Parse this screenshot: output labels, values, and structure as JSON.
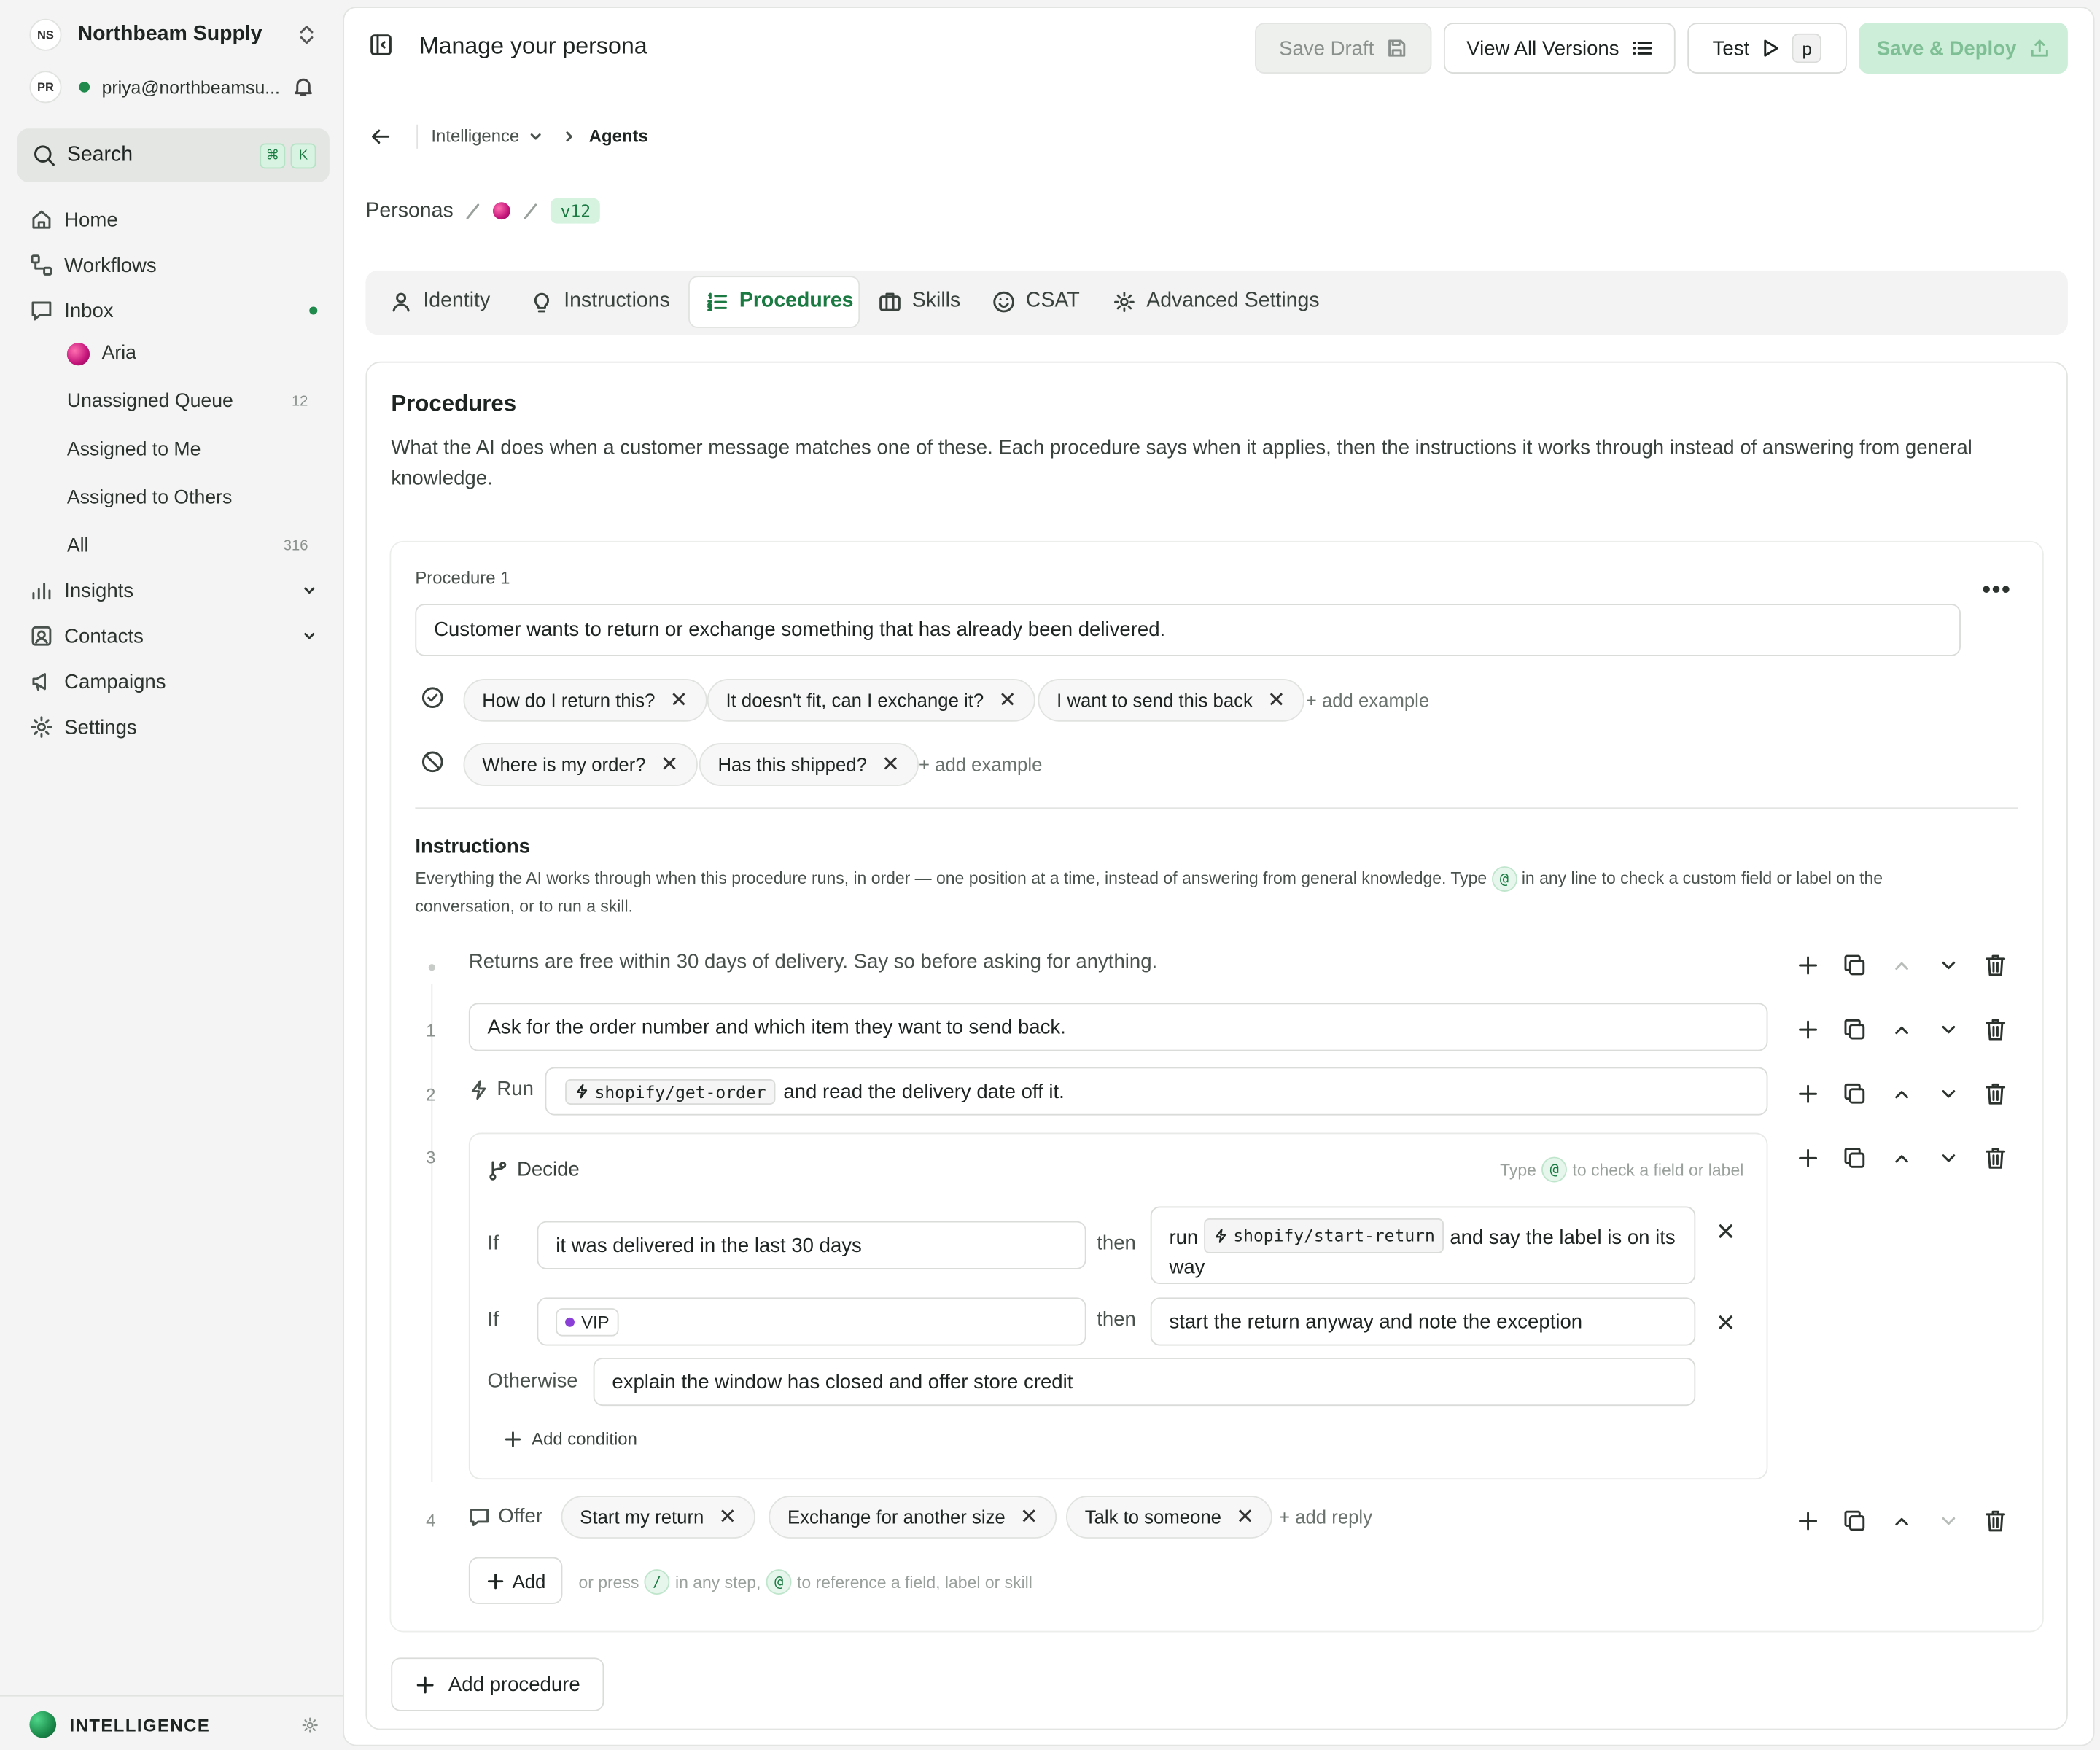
{
  "workspace": {
    "initials": "NS",
    "name": "Northbeam Supply",
    "user_initials": "PR",
    "user_email": "priya@northbeamsu...",
    "status_color": "#1f8a4c"
  },
  "search": {
    "label": "Search",
    "shortcut_mod": "⌘",
    "shortcut_key": "K"
  },
  "nav": {
    "home": "Home",
    "workflows": "Workflows",
    "inbox": "Inbox",
    "inbox_items": [
      {
        "label": "Aria",
        "count": ""
      },
      {
        "label": "Unassigned Queue",
        "count": "12"
      },
      {
        "label": "Assigned to Me",
        "count": ""
      },
      {
        "label": "Assigned to Others",
        "count": ""
      },
      {
        "label": "All",
        "count": "316"
      }
    ],
    "insights": "Insights",
    "contacts": "Contacts",
    "campaigns": "Campaigns",
    "settings": "Settings"
  },
  "footer": {
    "brand": "INTELLIGENCE"
  },
  "header": {
    "title": "Manage your persona",
    "save_draft": "Save Draft",
    "view_versions": "View All Versions",
    "test": "Test",
    "test_shortcut": "p",
    "save_deploy": "Save & Deploy"
  },
  "breadcrumb": {
    "section": "Intelligence",
    "current": "Agents"
  },
  "persona_path": {
    "root": "Personas",
    "version": "v12"
  },
  "tabs": [
    "Identity",
    "Instructions",
    "Procedures",
    "Skills",
    "CSAT",
    "Advanced Settings"
  ],
  "active_tab": "Procedures",
  "procedures": {
    "title": "Procedures",
    "description": "What the AI does when a customer message matches one of these. Each procedure says when it applies, then the instructions it works through instead of answering from general knowledge.",
    "procedure": {
      "label": "Procedure 1",
      "trigger": "Customer wants to return or exchange something that has already been delivered.",
      "positive_examples": [
        "How do I return this?",
        "It doesn't fit, can I exchange it?",
        "I want to send this back"
      ],
      "negative_examples": [
        "Where is my order?",
        "Has this shipped?"
      ],
      "add_example": "+ add example",
      "instructions_title": "Instructions",
      "instructions_desc_before": "Everything the AI works through when this procedure runs, in order — one position at a time, instead of answering from general knowledge. Type",
      "instructions_desc_after": "in any line to check a custom field or label on the conversation, or to run a skill.",
      "at_symbol": "@",
      "note": "Returns are free within 30 days of delivery. Say so before asking for anything.",
      "step1": {
        "num": "1",
        "text": "Ask for the order number and which item they want to send back."
      },
      "step2": {
        "num": "2",
        "verb": "Run",
        "skill": "shopify/get-order",
        "rest": "and read the delivery date off it."
      },
      "step3": {
        "num": "3",
        "verb": "Decide",
        "hint": "to check a field or label",
        "hint_prefix": "Type",
        "if_label": "If",
        "then_label": "then",
        "conditions": [
          {
            "if": "it was delivered in the last 30 days",
            "then_prefix": "run",
            "then_skill": "shopify/start-return",
            "then_rest": "and say the label is on its way"
          },
          {
            "if_label_chip": "VIP",
            "label_color": "#8a3fd6",
            "then": "start the return anyway and note the exception"
          }
        ],
        "otherwise_label": "Otherwise",
        "otherwise": "explain the window has closed and offer store credit",
        "add_condition": "Add condition"
      },
      "step4": {
        "num": "4",
        "verb": "Offer",
        "replies": [
          "Start my return",
          "Exchange for another size",
          "Talk to someone"
        ],
        "add_reply": "+ add reply"
      },
      "add_step": "Add",
      "add_hint_1": "or press",
      "slash": "/",
      "add_hint_2": "in any step,",
      "add_hint_3": "to reference a field, label or skill"
    },
    "add_procedure": "Add procedure"
  },
  "colors": {
    "accent": "#1a7a42",
    "accent_light": "#e6f6ec",
    "deploy_bg": "#cdeed8",
    "deploy_text": "#7fbf95"
  }
}
